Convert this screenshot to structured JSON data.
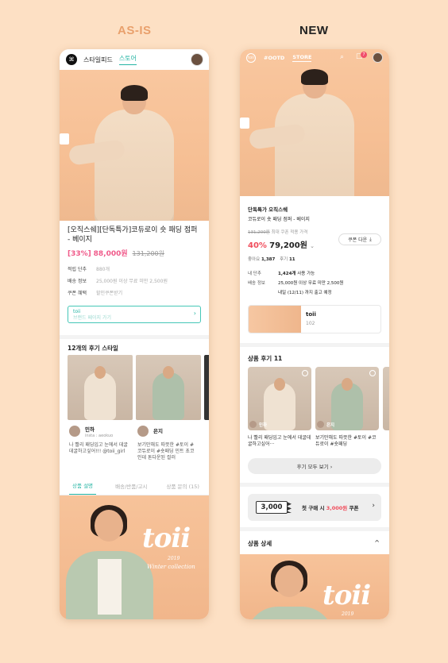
{
  "headers": {
    "asis": "AS-IS",
    "new": "NEW"
  },
  "asis": {
    "topbar": {
      "logo": "⌘",
      "tabs": [
        "스타일피드",
        "스토어"
      ],
      "active_tab": "스토어"
    },
    "product": {
      "name": "[오직스쉐][단독특가]코듀로이 숏 패딩 점퍼 - 베이지",
      "discount": "[33%]",
      "price": "88,000원",
      "original": "131,200원"
    },
    "info": [
      {
        "k": "적립 단추",
        "v": "880개"
      },
      {
        "k": "배송 정보",
        "v": "25,000원 이상 무료 미만 2,500원"
      },
      {
        "k": "쿠폰 혜택",
        "v": "할인쿠폰받기"
      }
    ],
    "brand_box": {
      "name": "toii",
      "sub": "브랜드 페이지 가기",
      "chevron": "›"
    },
    "reviews_title": "12개의 후기 스타일",
    "reviews": [
      {
        "name": "민하",
        "sub": "insta : aeokuo",
        "text": "나 빨리 패딩입고 눈에서 데굴데굴하고싶어!!! @toii_girl"
      },
      {
        "name": "은지",
        "sub": "",
        "text": "보기만해도 따뜻한 #토이 #코듀로이 #숏패딩 민트 초코인데 톤다운된 컬러"
      }
    ],
    "tabs": [
      "상품 설명",
      "배송/반품/고시",
      "상품 문의 (15)"
    ],
    "banner": {
      "logo": "toii",
      "year": "2019",
      "sub": "Winter collection"
    }
  },
  "new": {
    "topbar": {
      "logo": "toii",
      "tabs": [
        "#OOTD",
        "STORE"
      ],
      "active_tab": "STORE",
      "badge": "7"
    },
    "product": {
      "tags": "단독특가   오직스쉐",
      "name": "코듀로이 숏 패딩 점퍼 - 베이지",
      "original": "131,200원",
      "original_note": "최대 쿠폰 적용 가격",
      "discount": "40%",
      "price": "79,200원",
      "coupon_btn": "쿠폰 다운"
    },
    "stats": {
      "likes_label": "좋아요",
      "likes": "1,387",
      "reviews_label": "후기",
      "reviews": "11"
    },
    "info": [
      {
        "k": "내 단추",
        "v_strong": "1,424개",
        "v": " 사용 가능"
      },
      {
        "k": "배송 정보",
        "v_strong": "",
        "v": "25,000원 이상 무료 미만 2,500원"
      },
      {
        "k": "",
        "v_strong": "",
        "v": "내일 (12/11) 까지 출고 예정"
      }
    ],
    "brand": {
      "name": "toii",
      "count": "102"
    },
    "reviews_title": "상품 후기",
    "reviews_count": "11",
    "reviews": [
      {
        "name": "민하",
        "text": "나 빨리 패딩입고 눈에서 데굴데굴하고싶어···"
      },
      {
        "name": "은지",
        "text": "보기만해도 따뜻한 #토이 #코듀로이 #숏패딩"
      }
    ],
    "see_all": "후기 모두 보기 ›",
    "coupon": {
      "amount": "3,000",
      "text_a": "첫 구매 시 ",
      "text_b": "3,000원",
      "text_c": " 쿠폰",
      "chevron": "›"
    },
    "detail_title": "상품 상세",
    "detail_chev": "^",
    "banner": {
      "logo": "toii",
      "year": "2019"
    }
  }
}
